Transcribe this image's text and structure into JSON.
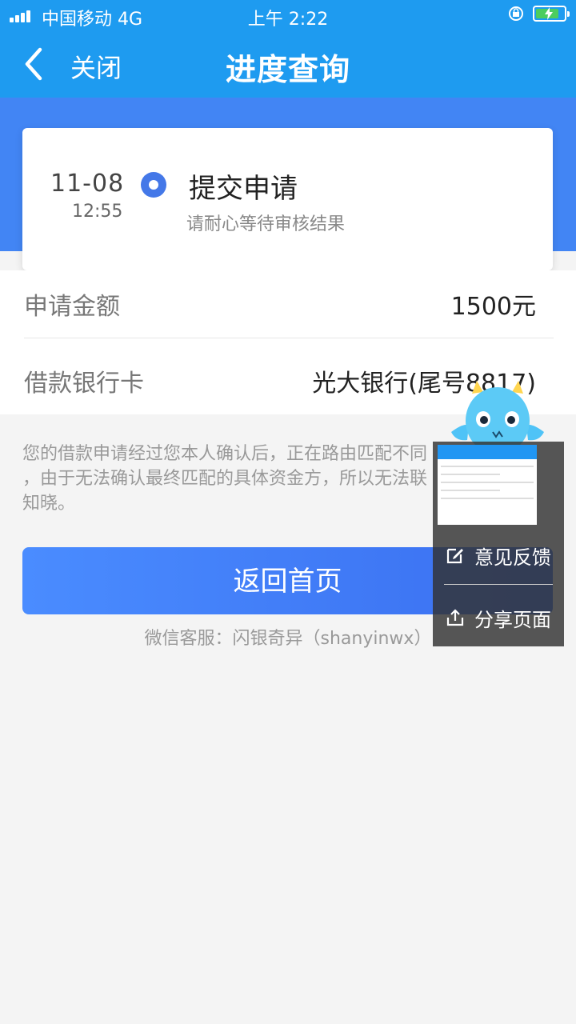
{
  "status_bar": {
    "carrier": "中国移动  4G",
    "time": "上午 2:22"
  },
  "nav": {
    "close": "关闭",
    "title": "进度查询"
  },
  "progress": {
    "date": "11-08",
    "time": "12:55",
    "step": "提交申请",
    "desc": "请耐心等待审核结果"
  },
  "info": {
    "rows": [
      {
        "label": "申请金额",
        "value": "1500元"
      },
      {
        "label": "借款银行卡",
        "value": "光大银行(尾号8817)"
      }
    ]
  },
  "notice": {
    "lines": [
      "您的借款申请经过您本人确认后，正在路由匹配不同",
      "，由于无法确认最终匹配的具体资金方，所以无法联",
      "知晓。"
    ]
  },
  "home_button": "返回首页",
  "wechat_service": "微信客服：闪银奇异（shanyinwx）",
  "float_menu": {
    "feedback": "意见反馈",
    "share": "分享页面"
  },
  "colors": {
    "nav": "#1e9bf0",
    "band": "#4285f4",
    "accent": "#4478e8"
  }
}
